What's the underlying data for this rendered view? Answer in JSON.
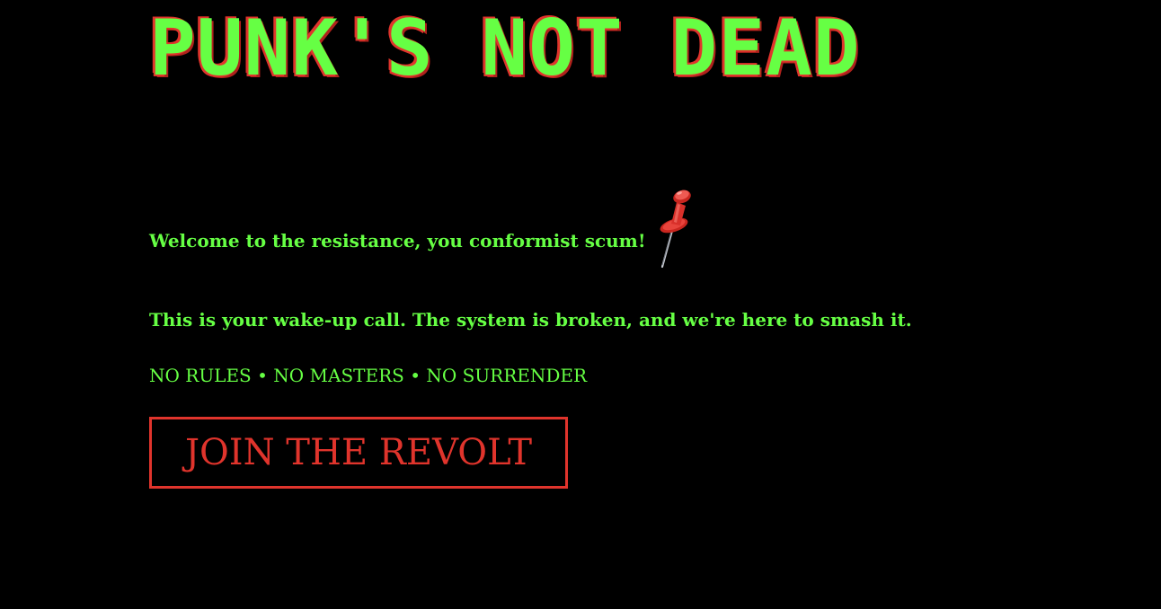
{
  "hero": {
    "title": "PUNK'S NOT DEAD",
    "welcome_text": "Welcome to the resistance, you conformist scum!",
    "pin_icon": "pushpin-icon",
    "paragraph": "This is your wake-up call. The system is broken, and we're here to smash it.",
    "slogan": "NO RULES • NO MASTERS • NO SURRENDER",
    "cta_label": "JOIN THE REVOLT"
  },
  "colors": {
    "background": "#000000",
    "text_green": "#66ff44",
    "accent_red": "#e0342c"
  }
}
